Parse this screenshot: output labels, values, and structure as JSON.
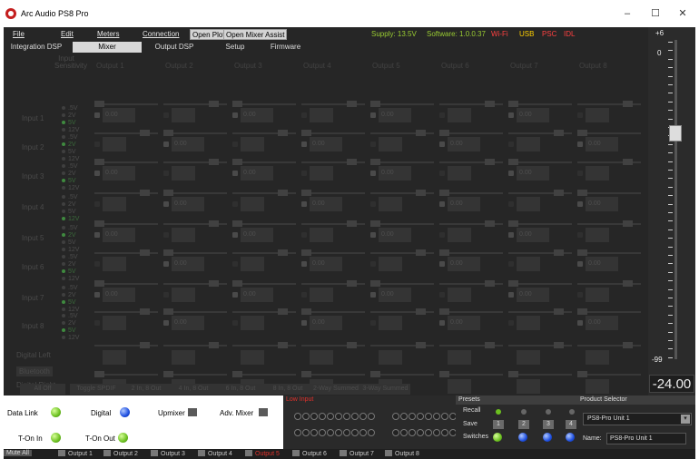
{
  "window": {
    "title": "Arc Audio PS8 Pro",
    "minimize_icon": "minimize-icon",
    "maximize_icon": "maximize-icon",
    "close_icon": "close-icon"
  },
  "menu": {
    "file": "File",
    "edit": "Edit",
    "meters": "Meters",
    "connection": "Connection",
    "open_plot": "Open Plot",
    "open_mixer_assist": "Open Mixer Assist"
  },
  "status_line": {
    "supply": "Supply: 13.5V",
    "software": "Software: 1.0.0.37",
    "wifi": "Wi-Fi",
    "usb": "USB",
    "psc": "PSC",
    "idl": "IDL"
  },
  "tabs": {
    "integration_dsp": "Integration DSP",
    "mixer": "Mixer",
    "output_dsp": "Output DSP",
    "setup": "Setup",
    "firmware": "Firmware",
    "active": "Mixer"
  },
  "grid": {
    "sensitivity_header": "Input Sensitivity",
    "outputs": [
      "Output 1",
      "Output 2",
      "Output 3",
      "Output 4",
      "Output 5",
      "Output 6",
      "Output 7",
      "Output 8"
    ],
    "inputs": [
      "Input 1",
      "Input 2",
      "Input 3",
      "Input 4",
      "Input 5",
      "Input 6",
      "Input 7",
      "Input 8"
    ],
    "sensitivity_options": [
      ".5V",
      "2V",
      "5V",
      "12V"
    ],
    "digital_left": "Digital Left",
    "bluetooth": "Bluetooth",
    "digital_right": "Digital Right",
    "value": "0.00"
  },
  "bottom_buttons": [
    "All Off",
    "Toggle SPDIF",
    "2 In, 8 Out",
    "4 In, 8 Out",
    "6 In, 8 Out",
    "8 In, 8 Out",
    "2-Way Summed",
    "3-Way Summed"
  ],
  "volume": {
    "max": "+6",
    "zero": "0",
    "min": "-99",
    "readout": "-24.00"
  },
  "status": {
    "data_link": "Data Link",
    "digital": "Digital",
    "upmixer": "Upmixer",
    "adv_mixer": "Adv. Mixer",
    "t_on_in": "T-On In",
    "t_on_out": "T-On Out",
    "low_input": "Low Input"
  },
  "presets": {
    "title": "Presets",
    "recall": "Recall",
    "save": "Save",
    "switches": "Switches",
    "numbers": [
      "1",
      "2",
      "3",
      "4"
    ]
  },
  "product": {
    "title": "Product Selector",
    "selected": "PS8-Pro Unit 1",
    "name_label": "Name:",
    "name_value": "PS8-Pro Unit 1"
  },
  "output_row": {
    "mute_all": "Mute All",
    "outputs": [
      "Output 1",
      "Output 2",
      "Output 3",
      "Output 4",
      "Output 5",
      "Output 6",
      "Output 7",
      "Output 8"
    ]
  },
  "colors": {
    "supply_green": "#9acd32",
    "software_green": "#9acd32",
    "wifi": "#ff4040",
    "usb": "#ffd000",
    "psc": "#ff4040",
    "idl": "#ff4040",
    "low_input": "#e0312b"
  }
}
